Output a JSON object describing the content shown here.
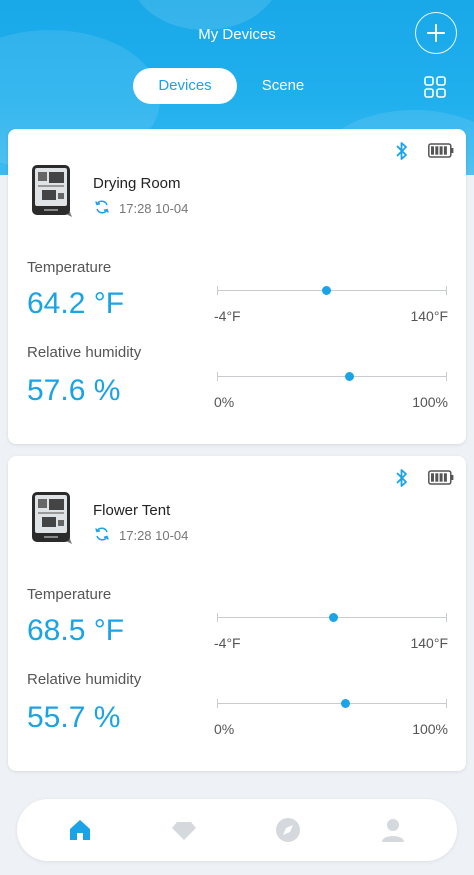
{
  "header": {
    "title": "My Devices",
    "tabs": [
      {
        "label": "Devices",
        "active": true
      },
      {
        "label": "Scene",
        "active": false
      }
    ]
  },
  "colors": {
    "accent": "#1aa3e6",
    "header_bg": "#19a8e8",
    "text_dark": "#222222",
    "text_muted": "#555555"
  },
  "devices": [
    {
      "name": "Drying Room",
      "sync_time": "17:28 10-04",
      "temperature": {
        "label": "Temperature",
        "value": "64.2 °F",
        "min_label": "-4°F",
        "max_label": "140°F",
        "min": -4,
        "max": 140,
        "level": 64.2
      },
      "humidity": {
        "label": "Relative humidity",
        "value": "57.6 %",
        "min_label": "0%",
        "max_label": "100%",
        "min": 0,
        "max": 100,
        "level": 57.6
      }
    },
    {
      "name": "Flower Tent",
      "sync_time": "17:28 10-04",
      "temperature": {
        "label": "Temperature",
        "value": "68.5 °F",
        "min_label": "-4°F",
        "max_label": "140°F",
        "min": -4,
        "max": 140,
        "level": 68.5
      },
      "humidity": {
        "label": "Relative humidity",
        "value": "55.7 %",
        "min_label": "0%",
        "max_label": "100%",
        "min": 0,
        "max": 100,
        "level": 55.7
      }
    }
  ],
  "icons": {
    "add": "plus-icon",
    "grid": "grid-icon",
    "bluetooth": "bluetooth-icon",
    "battery": "battery-icon",
    "sync": "sync-icon",
    "nav": [
      "home-icon",
      "diamond-icon",
      "compass-icon",
      "user-icon"
    ]
  },
  "bottom_nav": {
    "active": "home"
  }
}
